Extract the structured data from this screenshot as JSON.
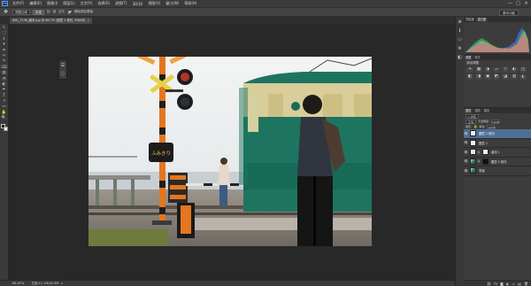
{
  "app": {
    "logo": "Ps"
  },
  "menu": [
    "文件(F)",
    "编辑(E)",
    "图像(I)",
    "图层(L)",
    "文字(Y)",
    "选择(S)",
    "滤镜(T)",
    "3D(D)",
    "视图(V)",
    "窗口(W)",
    "帮助(H)"
  ],
  "window_controls": [
    "—",
    "□",
    "✕"
  ],
  "options": {
    "tool_icon": "move-tool-icon",
    "preset": "调整边缘",
    "new_button": "新建",
    "buttons": [
      "加",
      "减",
      "交叉"
    ],
    "check_label": "删除剪贴蒙版",
    "workspace": "基本功能"
  },
  "document_tab": {
    "title": "IMG_7236_副本.jpg @ 66.7% (图层 1 拷贝, RGB/8)",
    "close": "×"
  },
  "tools": [
    "↖",
    "⬚",
    "ℓ",
    "✦",
    "⌗",
    "✑",
    "✎",
    "⌫",
    "▤",
    "◔",
    "◐",
    "✒",
    "T",
    "↗",
    "▭",
    "✋",
    "🔍"
  ],
  "floating_panel": {
    "icons": [
      "☰",
      "ⓘ"
    ]
  },
  "status": {
    "zoom": "66.67%",
    "doc": "文档:11.1M/45.9M",
    "arrow": "▸"
  },
  "right_strip_icons": [
    "⊕",
    "ℹ",
    "▭",
    "⚙",
    "◧"
  ],
  "histogram_tabs": [
    "导航器",
    "直方图"
  ],
  "adjustments": {
    "tabs": [
      "调整",
      "样式"
    ],
    "title": "添加调整",
    "icons": [
      "☀",
      "▦",
      "◑",
      "▱",
      "▽",
      "◐",
      "◫",
      "◧",
      "◨",
      "▣",
      "◩",
      "◪",
      "▥",
      "◭"
    ]
  },
  "layers": {
    "tabs": [
      "图层",
      "通道",
      "路径"
    ],
    "kind": "ρ 类型",
    "blend": "正常",
    "opacity_label": "不透明度:",
    "opacity": "100%",
    "lock_label": "锁定:",
    "fill_label": "填充:",
    "fill": "100%",
    "items": [
      {
        "name": "图层 1 拷贝",
        "thumb": "white",
        "selected": true
      },
      {
        "name": "图层 1",
        "thumb": "white",
        "selected": false
      },
      {
        "name": "曲线 1",
        "thumb": "adj",
        "selected": false
      },
      {
        "name": "图层 0 拷贝",
        "thumb": "black",
        "selected": false
      },
      {
        "name": "背景",
        "thumb": "photo-t",
        "selected": false
      }
    ],
    "bottom_icons": [
      "⛓",
      "fx",
      "◙",
      "◐",
      "▭",
      "▤",
      "🗑"
    ]
  },
  "photo_sign": "ふみきり"
}
